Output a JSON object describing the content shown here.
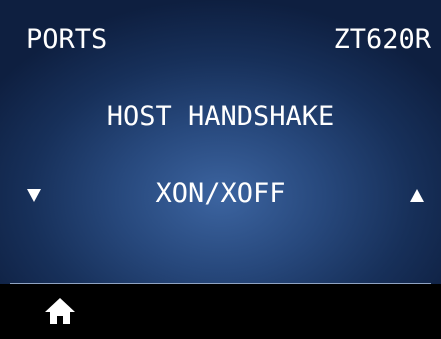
{
  "header": {
    "section": "PORTS",
    "model": "ZT620R"
  },
  "setting": {
    "name": "HOST HANDSHAKE",
    "value": "XON/XOFF"
  },
  "icons": {
    "prev": "down-arrow-icon",
    "next": "up-arrow-icon",
    "home": "home-icon"
  },
  "colors": {
    "background_center": "#3c64a0",
    "background_edge": "#0e1f40",
    "text": "#ffffff",
    "bottom_bar": "#000000"
  }
}
